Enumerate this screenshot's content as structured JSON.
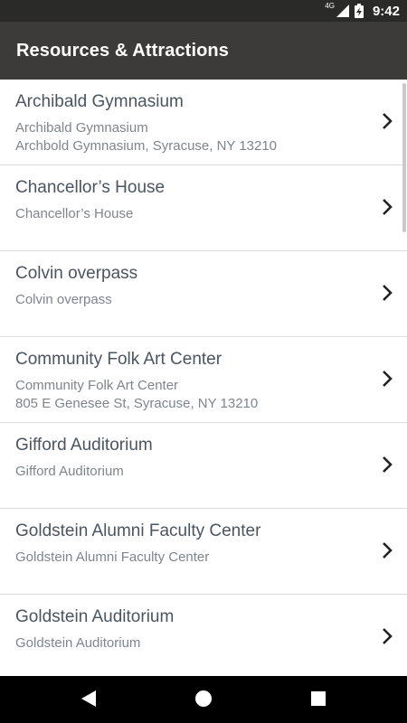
{
  "status_bar": {
    "network": "4G",
    "time": "9:42"
  },
  "app_bar": {
    "title": "Resources & Attractions"
  },
  "list": [
    {
      "name": "Archibald Gymnasium",
      "sub1": "Archibald Gymnasium",
      "sub2": "Archbold Gymnasium, Syracuse, NY 13210"
    },
    {
      "name": "Chancellor’s House",
      "sub1": "Chancellor’s House",
      "sub2": ""
    },
    {
      "name": "Colvin overpass",
      "sub1": "Colvin overpass",
      "sub2": ""
    },
    {
      "name": "Community Folk Art Center",
      "sub1": "Community Folk Art Center",
      "sub2": "805 E Genesee St, Syracuse, NY 13210"
    },
    {
      "name": "Gifford Auditorium",
      "sub1": "Gifford Auditorium",
      "sub2": ""
    },
    {
      "name": "Goldstein Alumni Faculty Center",
      "sub1": "Goldstein Alumni Faculty Center",
      "sub2": ""
    },
    {
      "name": "Goldstein Auditorium",
      "sub1": "Goldstein Auditorium",
      "sub2": ""
    }
  ],
  "icons": {
    "chevron": "chevron-right-icon",
    "back": "back-triangle-icon",
    "home": "home-circle-icon",
    "recents": "recents-square-icon"
  },
  "colors": {
    "status_bar": "#2a2a28",
    "app_bar": "#3c3b39",
    "title_text": "#4a5560",
    "subtitle_text": "#7f858a",
    "divider": "#dddddd"
  }
}
